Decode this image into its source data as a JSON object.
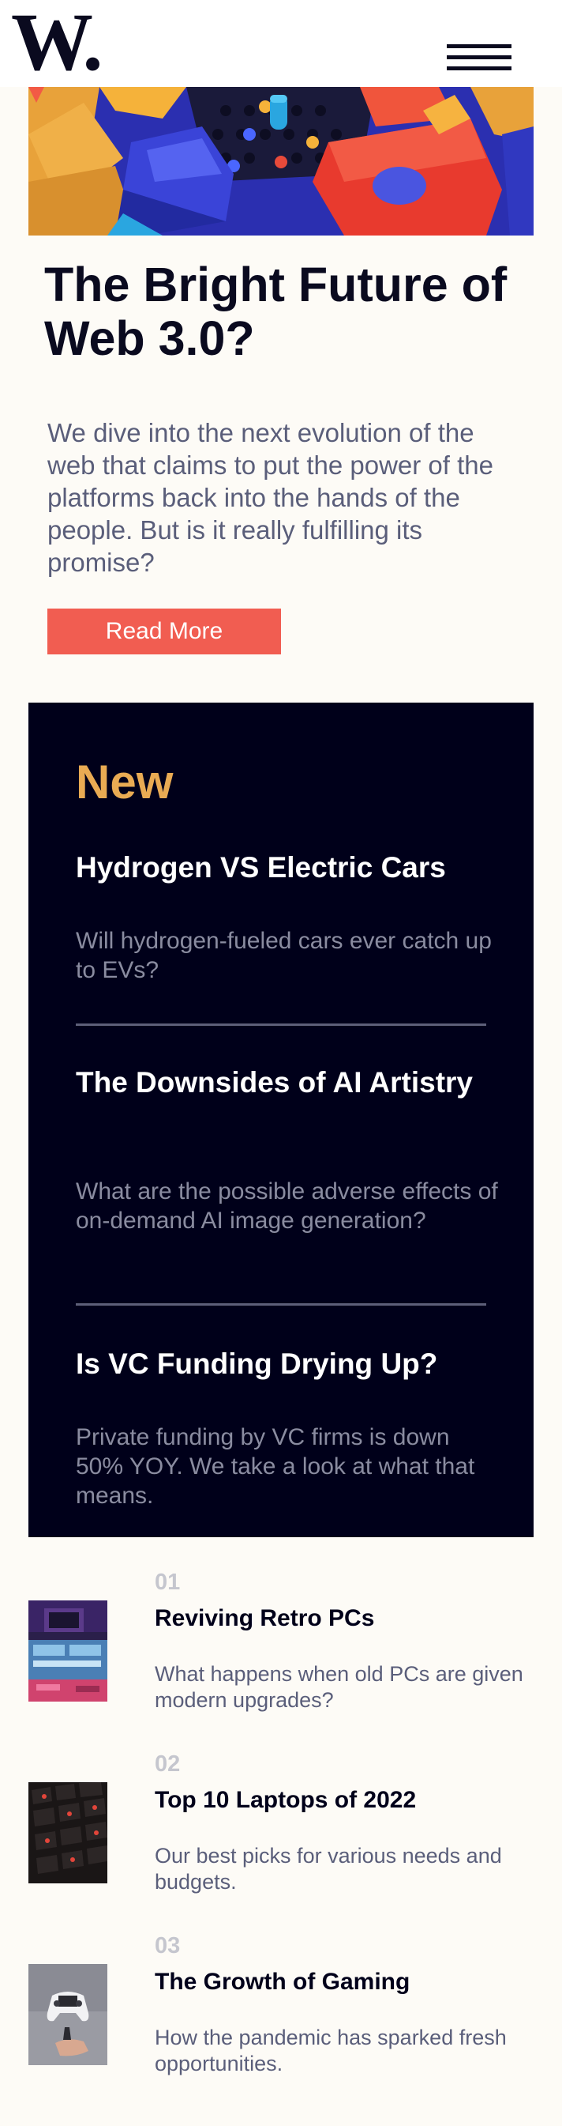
{
  "header": {
    "logo": "W.",
    "menu_icon": "hamburger-menu-icon"
  },
  "hero": {
    "image_icon": "abstract-3d-shapes-image",
    "title": "The Bright Future of Web 3.0?",
    "description": "We dive into the next evolution of the web that claims to put the power of the platforms back into the hands of the people. But is it really fulfilling its promise?",
    "button_label": "Read More"
  },
  "new_section": {
    "heading": "New",
    "items": [
      {
        "title": "Hydrogen VS Electric Cars",
        "description": "Will hydrogen-fueled cars ever catch up to EVs?"
      },
      {
        "title": "The Downsides of AI Artistry",
        "description": "What are the possible adverse effects of on-demand AI image generation?"
      },
      {
        "title": "Is VC Funding Drying Up?",
        "description": "Private funding by VC firms is down 50% YOY. We take a look at what that means."
      }
    ]
  },
  "numbered_list": [
    {
      "number": "01",
      "title": "Reviving Retro PCs",
      "description": "What happens when old PCs are given modern upgrades?",
      "image": "retro-pc-image"
    },
    {
      "number": "02",
      "title": "Top 10 Laptops of 2022",
      "description": "Our best picks for various needs and budgets.",
      "image": "laptop-keyboard-image"
    },
    {
      "number": "03",
      "title": "The Growth of Gaming",
      "description": "How the pandemic has sparked fresh opportunities.",
      "image": "game-controller-image"
    }
  ],
  "colors": {
    "background": "#fdfbf6",
    "dark": "#00001a",
    "accent_red": "#f15d51",
    "accent_orange": "#e9ab53",
    "muted_text": "#5a5e7a"
  }
}
